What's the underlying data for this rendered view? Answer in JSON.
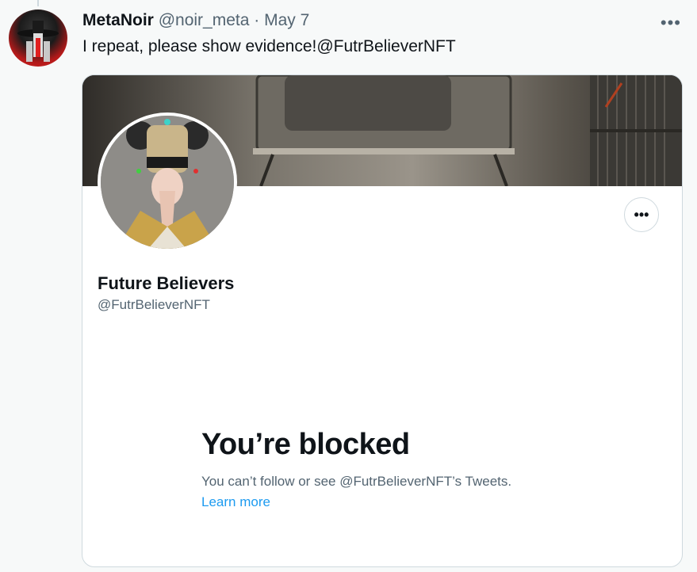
{
  "tweet": {
    "author": "MetaNoir",
    "handle": "@noir_meta",
    "separator": "·",
    "date": "May 7",
    "more_icon": "•••",
    "text": "I repeat, please show evidence!@FutrBelieverNFT"
  },
  "card": {
    "banner_text": "Future Believers",
    "display_name": "Future Believers",
    "handle": "@FutrBelieverNFT",
    "more_icon": "•••",
    "blocked_title": "You’re blocked",
    "blocked_desc": "You can’t follow or see @FutrBelieverNFT’s Tweets.",
    "learn_more": "Learn more"
  },
  "colors": {
    "text_primary": "#0f1419",
    "text_secondary": "#536471",
    "link": "#1d9bf0",
    "border": "#cfd9de",
    "background": "#f7f9f9"
  }
}
